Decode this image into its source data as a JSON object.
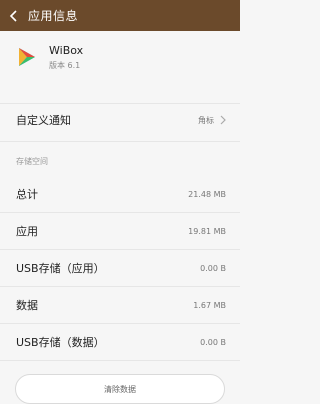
{
  "topbar": {
    "title": "应用信息",
    "back_icon": "chevron-left-icon"
  },
  "app": {
    "name": "WiBox",
    "version": "版本 6.1",
    "icon": "play-triangle-icon"
  },
  "notification": {
    "label": "自定义通知",
    "value": "角标",
    "chevron_icon": "chevron-right-icon"
  },
  "storage": {
    "section_title": "存储空间",
    "rows": [
      {
        "label": "总计",
        "value": "21.48 MB"
      },
      {
        "label": "应用",
        "value": "19.81 MB"
      },
      {
        "label": "USB存储（应用）",
        "value": "0.00 B"
      },
      {
        "label": "数据",
        "value": "1.67 MB"
      },
      {
        "label": "USB存储（数据）",
        "value": "0.00 B"
      }
    ]
  },
  "actions": {
    "clear_data_label": "清除数据"
  },
  "colors": {
    "topbar": "#6b4a2b",
    "background": "#f6f6f6"
  }
}
